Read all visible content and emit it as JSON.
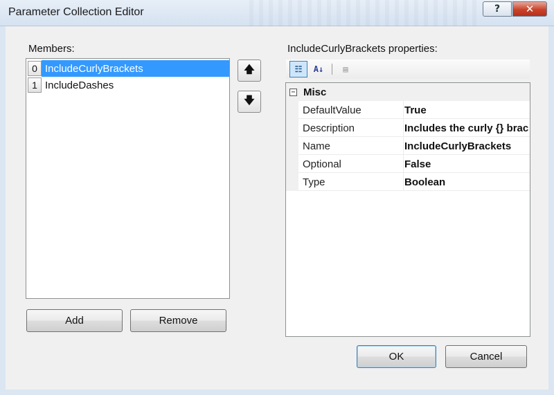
{
  "window": {
    "title": "Parameter Collection Editor",
    "help_glyph": "?",
    "close_glyph": "✕"
  },
  "members": {
    "label": "Members:",
    "items": [
      {
        "index": "0",
        "name": "IncludeCurlyBrackets",
        "selected": true
      },
      {
        "index": "1",
        "name": "IncludeDashes",
        "selected": false
      }
    ],
    "move_up_glyph": "🡅",
    "move_down_glyph": "🡇"
  },
  "buttons": {
    "add": "Add",
    "remove": "Remove",
    "ok": "OK",
    "cancel": "Cancel"
  },
  "properties": {
    "label": "IncludeCurlyBrackets properties:",
    "toolbar": {
      "categorized_glyph": "☷",
      "alpha_sort_glyph": "A↓",
      "property_pages_glyph": "▤"
    },
    "category": {
      "expander": "−",
      "name": "Misc"
    },
    "rows": [
      {
        "name": "DefaultValue",
        "value": "True"
      },
      {
        "name": "Description",
        "value": "Includes the curly {} brac"
      },
      {
        "name": "Name",
        "value": "IncludeCurlyBrackets"
      },
      {
        "name": "Optional",
        "value": "False"
      },
      {
        "name": "Type",
        "value": "Boolean"
      }
    ]
  },
  "colors": {
    "selection": "#3399ff",
    "close_button": "#c8432b",
    "dialog_background": "#f0f0f0"
  }
}
